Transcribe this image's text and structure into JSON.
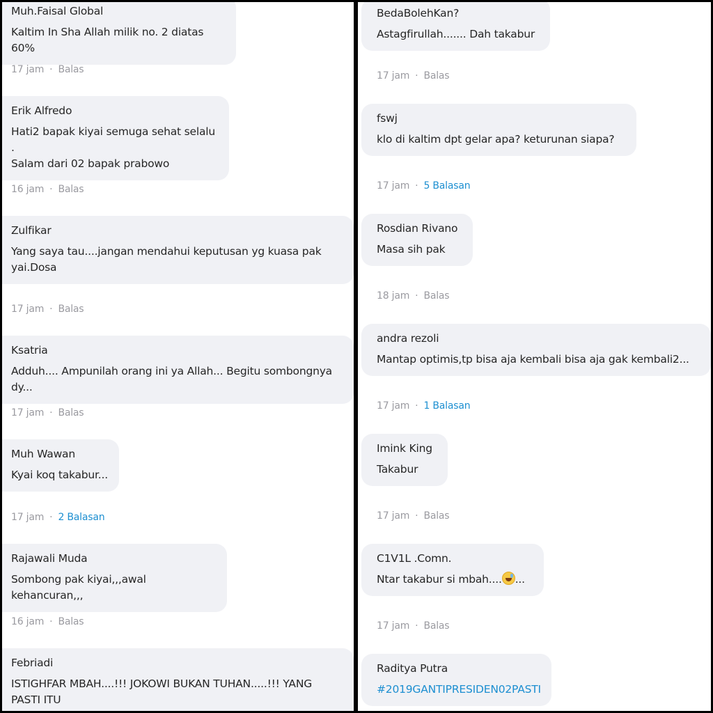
{
  "left_comments": [
    {
      "name": "Muh.Faisal Global",
      "text": "Kaltim In Sha Allah milik no. 2 diatas 60%",
      "time": "17 jam",
      "action": "Balas"
    },
    {
      "name": "Erik Alfredo",
      "text": "Hati2 bapak kiyai semuga sehat selalu .\nSalam dari 02 bapak prabowo",
      "time": "16 jam",
      "action": "Balas"
    },
    {
      "name": "Zulfikar",
      "text": "Yang saya tau....jangan mendahui keputusan yg kuasa pak\nyai.Dosa",
      "time": "17 jam",
      "action": "Balas"
    },
    {
      "name": "Ksatria",
      "text": "Adduh.... Ampunilah orang ini ya Allah... Begitu sombongnya dy...",
      "time": "17 jam",
      "action": "Balas"
    },
    {
      "name": "Muh Wawan",
      "text": "Kyai koq takabur...",
      "time": "17 jam",
      "action": "2 Balasan"
    },
    {
      "name": "Rajawali Muda",
      "text": "Sombong pak kiyai,,,awal kehancuran,,,",
      "time": "16 jam",
      "action": "Balas"
    },
    {
      "name": "Febriadi",
      "text": "ISTIGHFAR MBAH....!!! JOKOWI BUKAN TUHAN.....!!! YANG PASTI ITU\nADALAH .....",
      "time": "",
      "action": ""
    }
  ],
  "right_comments": [
    {
      "name": "BedaBolehKan?",
      "text": "Astagfirullah....... Dah takabur",
      "time": "17 jam",
      "action": "Balas"
    },
    {
      "name": "fswj",
      "text": "klo di kaltim dpt gelar apa? keturunan siapa?",
      "time": "17 jam",
      "action": "5 Balasan"
    },
    {
      "name": "Rosdian Rivano",
      "text": "Masa sih pak",
      "time": "18 jam",
      "action": "Balas"
    },
    {
      "name": "andra rezoli",
      "text": "Mantap optimis,tp bisa aja kembali bisa aja gak kembali2...",
      "time": "17 jam",
      "action": "1 Balasan"
    },
    {
      "name": "Imink King",
      "text": "Takabur",
      "time": "17 jam",
      "action": "Balas"
    },
    {
      "name": "C1V1L .Comn.",
      "text": "Ntar takabur si mbah....",
      "text_suffix": "...",
      "emoji": "grinning-sweat-emoji",
      "time": "17 jam",
      "action": "Balas"
    },
    {
      "name": "Raditya Putra",
      "text": "#2019GANTIPRESIDEN02PASTI",
      "hashtag": true,
      "time": "",
      "action": ""
    }
  ],
  "separator": "·",
  "colors": {
    "bubble": "#f0f1f5",
    "text": "#262626",
    "meta": "#9a9aa0",
    "link": "#1d8fd1",
    "divider": "#000000"
  }
}
